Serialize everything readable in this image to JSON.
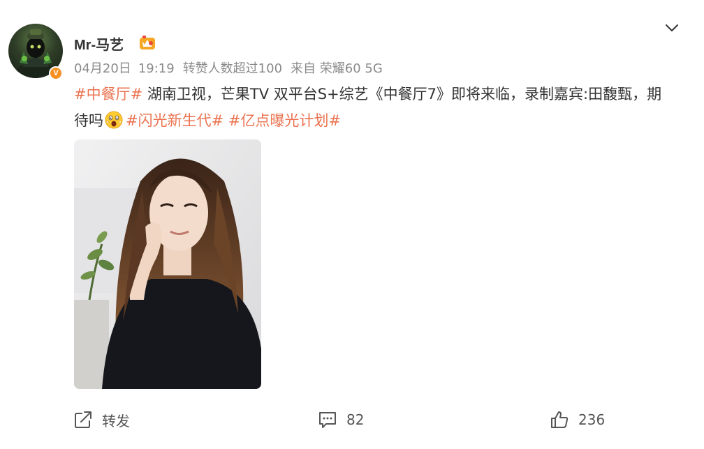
{
  "post": {
    "username": "Mr-马艺",
    "verified_badge": "V",
    "meta": {
      "date": "04月20日",
      "time": "19:19",
      "repost_note": "转赞人数超过100",
      "source": "来自 荣耀60 5G"
    },
    "text": {
      "hashtag_1": "#中餐厅#",
      "body_1": " 湖南卫视，芒果TV 双平台S+综艺《中餐厅7》即将来临，录制嘉宾:田馥甄，期待吗",
      "emoji": "scream-emoji",
      "hashtag_2": "#闪光新生代#",
      "hashtag_3": "#亿点曝光计划#"
    },
    "photo": {
      "icon": "portrait-photo"
    },
    "actions": {
      "repost_label": "转发",
      "comment_count": "82",
      "like_count": "236"
    }
  },
  "colors": {
    "hashtag": "#eb7350",
    "meta_text": "#8a8a8a",
    "body_text": "#333333",
    "verified_badge": "#f79020"
  }
}
